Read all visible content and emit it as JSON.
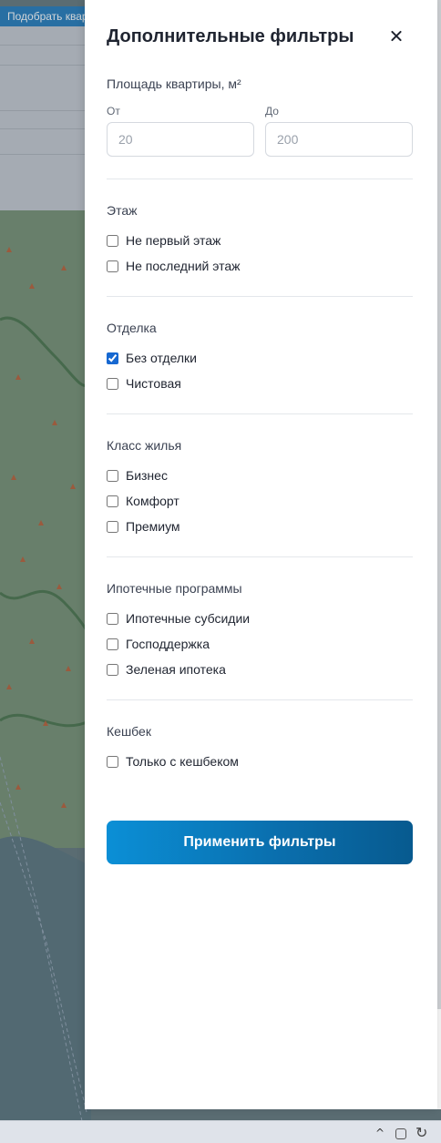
{
  "background": {
    "topbar_label": "Подобрать квартиру"
  },
  "filters": {
    "title": "Дополнительные фильтры",
    "area": {
      "title": "Площадь квартиры, м²",
      "from_label": "От",
      "from_placeholder": "20",
      "to_label": "До",
      "to_placeholder": "200"
    },
    "floor": {
      "title": "Этаж",
      "options": [
        {
          "label": "Не первый этаж",
          "checked": false
        },
        {
          "label": "Не последний этаж",
          "checked": false
        }
      ]
    },
    "finish": {
      "title": "Отделка",
      "options": [
        {
          "label": "Без отделки",
          "checked": true
        },
        {
          "label": "Чистовая",
          "checked": false
        }
      ]
    },
    "housing_class": {
      "title": "Класс жилья",
      "options": [
        {
          "label": "Бизнес",
          "checked": false
        },
        {
          "label": "Комфорт",
          "checked": false
        },
        {
          "label": "Премиум",
          "checked": false
        }
      ]
    },
    "mortgage": {
      "title": "Ипотечные программы",
      "options": [
        {
          "label": "Ипотечные субсидии",
          "checked": false
        },
        {
          "label": "Господдержка",
          "checked": false
        },
        {
          "label": "Зеленая ипотека",
          "checked": false
        }
      ]
    },
    "cashback": {
      "title": "Кешбек",
      "options": [
        {
          "label": "Только с кешбеком",
          "checked": false
        }
      ]
    },
    "apply_label": "Применить фильтры"
  }
}
